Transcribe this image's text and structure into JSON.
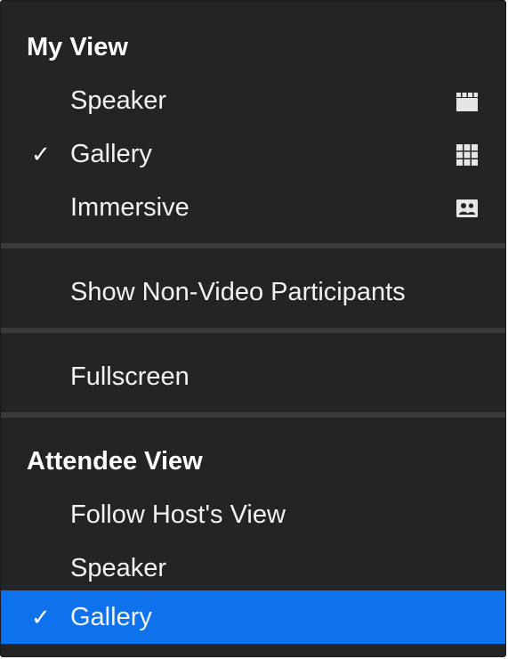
{
  "my_view": {
    "header": "My View",
    "items": [
      {
        "label": "Speaker",
        "checked": false,
        "icon": "speaker-view-icon"
      },
      {
        "label": "Gallery",
        "checked": true,
        "icon": "gallery-view-icon"
      },
      {
        "label": "Immersive",
        "checked": false,
        "icon": "immersive-view-icon"
      }
    ]
  },
  "options": {
    "show_non_video": "Show Non-Video Participants",
    "fullscreen": "Fullscreen"
  },
  "attendee_view": {
    "header": "Attendee View",
    "items": [
      {
        "label": "Follow Host's View",
        "checked": false
      },
      {
        "label": "Speaker",
        "checked": false
      },
      {
        "label": "Gallery",
        "checked": true,
        "highlighted": true
      }
    ]
  },
  "check_glyph": "✓",
  "colors": {
    "menu_background": "#242424",
    "divider": "#3a3a3a",
    "highlight": "#0e72ed",
    "text": "#f2f2f2"
  }
}
